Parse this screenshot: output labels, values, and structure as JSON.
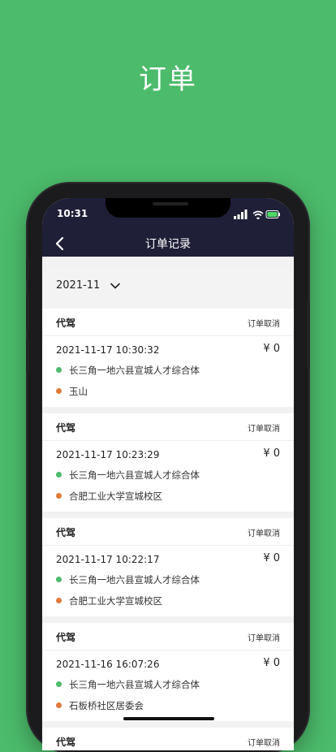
{
  "promo": {
    "title": "订单"
  },
  "status_bar": {
    "time": "10:31"
  },
  "nav": {
    "title": "订单记录"
  },
  "filter": {
    "month": "2021-11"
  },
  "colors": {
    "start_dot": "#4cbb6b",
    "end_dot": "#e07b39",
    "nav_bg": "#1f1f38"
  },
  "orders": [
    {
      "type": "代驾",
      "status": "订单取消",
      "time": "2021-11-17 10:30:32",
      "price": "¥ 0",
      "start": "长三角一地六县宣城人才综合体",
      "end": "玉山"
    },
    {
      "type": "代驾",
      "status": "订单取消",
      "time": "2021-11-17 10:23:29",
      "price": "¥ 0",
      "start": "长三角一地六县宣城人才综合体",
      "end": "合肥工业大学宣城校区"
    },
    {
      "type": "代驾",
      "status": "订单取消",
      "time": "2021-11-17 10:22:17",
      "price": "¥ 0",
      "start": "长三角一地六县宣城人才综合体",
      "end": "合肥工业大学宣城校区"
    },
    {
      "type": "代驾",
      "status": "订单取消",
      "time": "2021-11-16 16:07:26",
      "price": "¥ 0",
      "start": "长三角一地六县宣城人才综合体",
      "end": "石板桥社区居委会"
    },
    {
      "type": "代驾",
      "status": "订单取消",
      "time": "",
      "price": "",
      "start": "",
      "end": ""
    }
  ]
}
